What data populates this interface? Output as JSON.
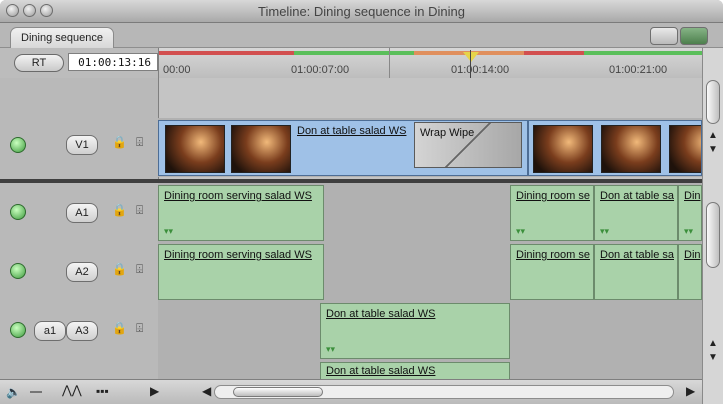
{
  "window": {
    "title": "Timeline: Dining sequence in Dining",
    "tab": "Dining sequence"
  },
  "toolbar": {
    "rt_label": "RT",
    "timecode": "01:00:13:16",
    "ticks": [
      "00:00",
      "01:00:07:00",
      "01:00:14:00",
      "01:00:21:00"
    ]
  },
  "tracks": {
    "video": {
      "label": "V1",
      "clips": [
        {
          "label": "Don at table salad WS"
        },
        {
          "label": "Wrap Wipe"
        }
      ]
    },
    "a1": {
      "label": "A1",
      "clips": [
        {
          "label": "Dining room serving salad WS"
        },
        {
          "label": "Dining room se"
        },
        {
          "label": "Don at table sa"
        },
        {
          "label": "Din"
        }
      ]
    },
    "a2": {
      "label": "A2",
      "clips": [
        {
          "label": "Dining room serving salad WS"
        },
        {
          "label": "Dining room se"
        },
        {
          "label": "Don at table sa"
        },
        {
          "label": "Din"
        }
      ]
    },
    "a3": {
      "source_label": "a1",
      "label": "A3",
      "clips": [
        {
          "label": "Don at table salad WS"
        }
      ]
    },
    "a4": {
      "clips": [
        {
          "label": "Don at table salad WS"
        }
      ]
    }
  },
  "icons": {
    "lock": "🔒",
    "sync": "⌹",
    "green_button": "●",
    "speaker": "🔈",
    "triangle_marks": "▾▾"
  },
  "colors": {
    "playhead": "#e6d44a",
    "render_red": "#d24f4f",
    "render_green": "#5bbf5b",
    "audio_clip": "#a9d2a9",
    "video_clip": "#9fc1e7"
  },
  "bottom": {
    "left_marker": "◀",
    "right_marker": "▶"
  }
}
